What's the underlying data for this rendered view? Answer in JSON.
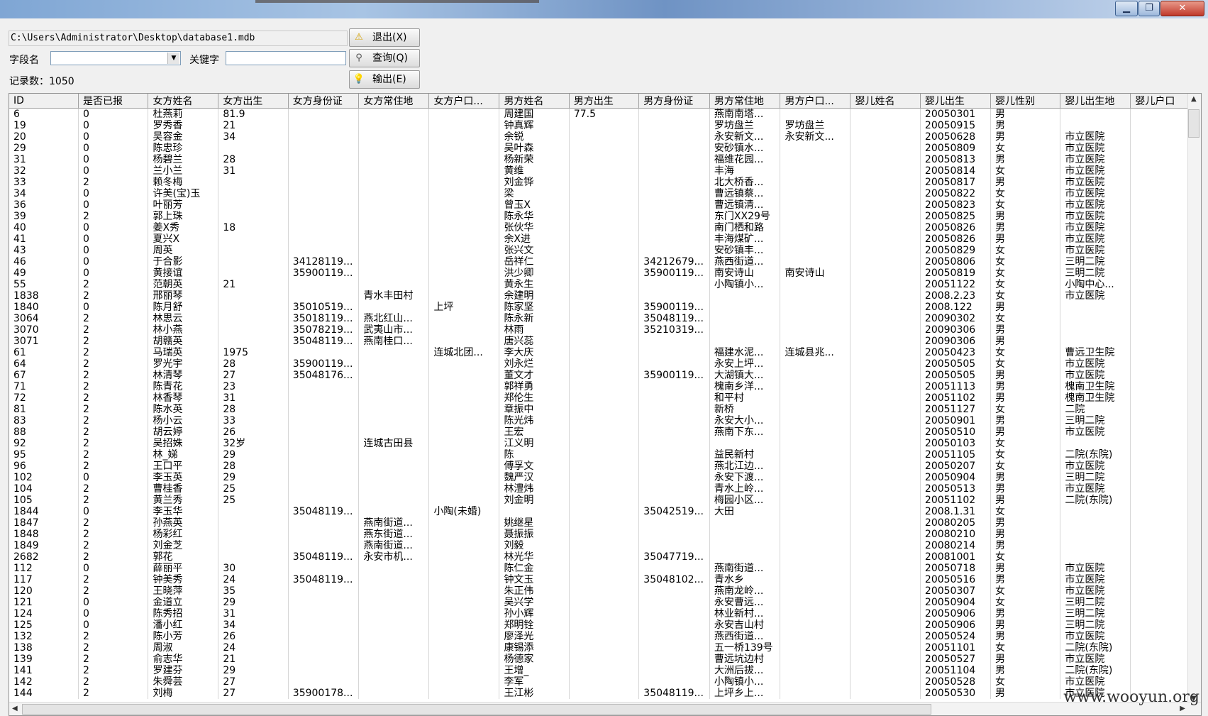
{
  "window": {
    "minimize_glyph": "▁",
    "maximize_glyph": "❐",
    "close_glyph": "✕"
  },
  "toolbar": {
    "path": "C:\\Users\\Administrator\\Desktop\\database1.mdb",
    "field_label": "字段名",
    "field_value": "",
    "keyword_label": "关键字",
    "keyword_value": "",
    "record_count_text": "记录数：1050",
    "exit_label": "退出(X)",
    "query_label": "查询(Q)",
    "export_label": "输出(E)",
    "exit_icon": "warning-icon",
    "query_icon": "search-icon",
    "export_icon": "lightbulb-icon"
  },
  "grid": {
    "columns": [
      "ID",
      "是否已报",
      "女方姓名",
      "女方出生",
      "女方身份证",
      "女方常住地",
      "女方户口...",
      "男方姓名",
      "男方出生",
      "男方身份证",
      "男方常住地",
      "男方户口...",
      "婴儿姓名",
      "婴儿出生",
      "婴儿性别",
      "婴儿出生地",
      "婴儿户口"
    ],
    "rows": [
      [
        "6",
        "0",
        "杜燕莉",
        "81.9",
        "",
        "",
        "",
        "周建国",
        "77.5",
        "",
        "燕南南塔...",
        "",
        "",
        "20050301",
        "男",
        ""
      ],
      [
        "19",
        "0",
        "罗秀香",
        "21",
        "",
        "",
        "",
        "钟真辉",
        "",
        "",
        "罗坊盘兰",
        "罗坊盘兰",
        "",
        "20050915",
        "男",
        ""
      ],
      [
        "20",
        "0",
        "吴容金",
        "34",
        "",
        "",
        "",
        "余锐",
        "",
        "",
        "永安新文...",
        "永安新文...",
        "",
        "20050628",
        "男",
        "市立医院"
      ],
      [
        "29",
        "0",
        "陈忠珍",
        "",
        "",
        "",
        "",
        "吴叶森",
        "",
        "",
        "安砂镇水...",
        "",
        "",
        "20050809",
        "女",
        "市立医院"
      ],
      [
        "31",
        "0",
        "杨碧兰",
        "28",
        "",
        "",
        "",
        "杨新荣",
        "",
        "",
        "福维花园...",
        "",
        "",
        "20050813",
        "男",
        "市立医院"
      ],
      [
        "32",
        "0",
        "兰小兰",
        "31",
        "",
        "",
        "",
        "黄维",
        "",
        "",
        "丰海",
        "",
        "",
        "20050814",
        "女",
        "市立医院"
      ],
      [
        "33",
        "2",
        "赖冬梅",
        "",
        "",
        "",
        "",
        "刘金铧",
        "",
        "",
        "北大桥香...",
        "",
        "",
        "20050817",
        "男",
        "市立医院"
      ],
      [
        "34",
        "0",
        "许美(宝)玉",
        "",
        "",
        "",
        "",
        "梁",
        "",
        "",
        "曹远镇蔡...",
        "",
        "",
        "20050822",
        "女",
        "市立医院"
      ],
      [
        "36",
        "0",
        "叶丽芳",
        "",
        "",
        "",
        "",
        "曾玉X",
        "",
        "",
        "曹远镇清...",
        "",
        "",
        "20050823",
        "女",
        "市立医院"
      ],
      [
        "39",
        "2",
        "郭上珠",
        "",
        "",
        "",
        "",
        "陈永华",
        "",
        "",
        "东门XX29号",
        "",
        "",
        "20050825",
        "男",
        "市立医院"
      ],
      [
        "40",
        "0",
        "姜X秀",
        "18",
        "",
        "",
        "",
        "张伙华",
        "",
        "",
        "南门栖和路",
        "",
        "",
        "20050826",
        "男",
        "市立医院"
      ],
      [
        "41",
        "0",
        "夏兴X",
        "",
        "",
        "",
        "",
        "余X进",
        "",
        "",
        "丰海煤矿...",
        "",
        "",
        "20050826",
        "男",
        "市立医院"
      ],
      [
        "43",
        "0",
        "周英",
        "",
        "",
        "",
        "",
        "张兴文",
        "",
        "",
        "安砂镇丰...",
        "",
        "",
        "20050829",
        "女",
        "市立医院"
      ],
      [
        "46",
        "0",
        "于合影",
        "",
        "34128119...",
        "",
        "",
        "岳祥仁",
        "",
        "34212679...",
        "燕西街道...",
        "",
        "",
        "20050806",
        "女",
        "三明二院"
      ],
      [
        "49",
        "0",
        "黄接谊",
        "",
        "35900119...",
        "",
        "",
        "洪少卿",
        "",
        "35900119...",
        "南安诗山",
        "南安诗山",
        "",
        "20050819",
        "女",
        "三明二院"
      ],
      [
        "55",
        "2",
        "范朝英",
        "21",
        "",
        "",
        "",
        "黄永生",
        "",
        "",
        "小陶镇小...",
        "",
        "",
        "20051122",
        "女",
        "小陶中心..."
      ],
      [
        "1838",
        "2",
        "邢丽琴",
        "",
        "",
        "青水丰田村",
        "",
        "余建明",
        "",
        "",
        "",
        "",
        "",
        "2008.2.23",
        "女",
        "市立医院"
      ],
      [
        "1840",
        "0",
        "陈月舒",
        "",
        "35010519...",
        "",
        "上坪",
        "陈家坚",
        "",
        "35900119...",
        "",
        "",
        "",
        "2008.122",
        "男",
        ""
      ],
      [
        "3064",
        "2",
        "林思云",
        "",
        "35018119...",
        "燕北红山...",
        "",
        "陈永新",
        "",
        "35048119...",
        "",
        "",
        "",
        "20090302",
        "女",
        ""
      ],
      [
        "3070",
        "2",
        "林小燕",
        "",
        "35078219...",
        "武夷山市...",
        "",
        "林雨",
        "",
        "35210319...",
        "",
        "",
        "",
        "20090306",
        "男",
        ""
      ],
      [
        "3071",
        "2",
        "胡赣英",
        "",
        "35048119...",
        "燕南桂口...",
        "",
        "唐兴蕊",
        "",
        "",
        "",
        "",
        "",
        "20090306",
        "男",
        ""
      ],
      [
        "61",
        "2",
        "马瑞英",
        "1975",
        "",
        "",
        "连城北团...",
        "李大庆",
        "",
        "",
        "福建水泥...",
        "连城县兆...",
        "",
        "20050423",
        "女",
        "曹远卫生院"
      ],
      [
        "64",
        "2",
        "罗光宇",
        "28",
        "35900119...",
        "",
        "",
        "刘永烂",
        "",
        "",
        "永安上坪...",
        "",
        "",
        "20050505",
        "女",
        "市立医院"
      ],
      [
        "67",
        "2",
        "林清琴",
        "27",
        "35048176...",
        "",
        "",
        "董文才",
        "",
        "35900119...",
        "大湖镇大...",
        "",
        "",
        "20050505",
        "男",
        "市立医院"
      ],
      [
        "71",
        "2",
        "陈青花",
        "23",
        "",
        "",
        "",
        "郭祥勇",
        "",
        "",
        "槐南乡洋...",
        "",
        "",
        "20051113",
        "男",
        "槐南卫生院"
      ],
      [
        "72",
        "2",
        "林香琴",
        "31",
        "",
        "",
        "",
        "郑伦生",
        "",
        "",
        "和平村",
        "",
        "",
        "20051102",
        "男",
        "槐南卫生院"
      ],
      [
        "81",
        "2",
        "陈水英",
        "28",
        "",
        "",
        "",
        "章振中",
        "",
        "",
        "新桥",
        "",
        "",
        "20051127",
        "女",
        "二院"
      ],
      [
        "83",
        "2",
        "杨小云",
        "33",
        "",
        "",
        "",
        "陈光炜",
        "",
        "",
        "永安大小...",
        "",
        "",
        "20050901",
        "男",
        "三明二院"
      ],
      [
        "88",
        "2",
        "胡云婷",
        "26",
        "",
        "",
        "",
        "王宏",
        "",
        "",
        "燕南下东...",
        "",
        "",
        "20050510",
        "男",
        "市立医院"
      ],
      [
        "92",
        "2",
        "吴招姝",
        "32岁",
        "",
        "连城古田县",
        "",
        "江义明",
        "",
        "",
        "",
        "",
        "",
        "20050103",
        "女",
        ""
      ],
      [
        "95",
        "2",
        "林_娣",
        "29",
        "",
        "",
        "",
        "陈",
        "",
        "",
        "益民新村",
        "",
        "",
        "20051105",
        "女",
        "二院(东院)"
      ],
      [
        "96",
        "2",
        "王口平",
        "28",
        "",
        "",
        "",
        "傅孚文",
        "",
        "",
        "燕北江边...",
        "",
        "",
        "20050207",
        "女",
        "市立医院"
      ],
      [
        "102",
        "0",
        "李玉英",
        "29",
        "",
        "",
        "",
        "魏严汉",
        "",
        "",
        "永安下渡...",
        "",
        "",
        "20050904",
        "男",
        "三明二院"
      ],
      [
        "104",
        "2",
        "曹桂香",
        "25",
        "",
        "",
        "",
        "林澧炜",
        "",
        "",
        "青水上岭...",
        "",
        "",
        "20050513",
        "男",
        "市立医院"
      ],
      [
        "105",
        "2",
        "黄兰秀",
        "25",
        "",
        "",
        "",
        "刘金明",
        "",
        "",
        "梅园小区...",
        "",
        "",
        "20051102",
        "男",
        "二院(东院)"
      ],
      [
        "1844",
        "0",
        "李玉华",
        "",
        "35048119...",
        "",
        "小陶(未婚)",
        "",
        "",
        "35042519...",
        "大田",
        "",
        "",
        "2008.1.31",
        "女",
        ""
      ],
      [
        "1847",
        "2",
        "孙燕英",
        "",
        "",
        "燕南街道...",
        "",
        "姚继星",
        "",
        "",
        "",
        "",
        "",
        "20080205",
        "男",
        ""
      ],
      [
        "1848",
        "2",
        "杨彩红",
        "",
        "",
        "燕东街道...",
        "",
        "聂振振",
        "",
        "",
        "",
        "",
        "",
        "20080210",
        "男",
        ""
      ],
      [
        "1849",
        "2",
        "刘金芝",
        "",
        "",
        "燕南街道...",
        "",
        "刘毅",
        "",
        "",
        "",
        "",
        "",
        "20080214",
        "男",
        ""
      ],
      [
        "2682",
        "2",
        "郭花",
        "",
        "35048119...",
        "永安市机...",
        "",
        "林光华",
        "",
        "35047719...",
        "",
        "",
        "",
        "20081001",
        "女",
        ""
      ],
      [
        "112",
        "0",
        "薛丽平",
        "30",
        "",
        "",
        "",
        "陈仁金",
        "",
        "",
        "燕南街道...",
        "",
        "",
        "20050718",
        "男",
        "市立医院"
      ],
      [
        "117",
        "2",
        "钟美秀",
        "24",
        "35048119...",
        "",
        "",
        "钟文玉",
        "",
        "35048102...",
        "青水乡",
        "",
        "",
        "20050516",
        "男",
        "市立医院"
      ],
      [
        "120",
        "2",
        "王晓萍",
        "35",
        "",
        "",
        "",
        "朱正伟",
        "",
        "",
        "燕南龙岭...",
        "",
        "",
        "20050307",
        "女",
        "市立医院"
      ],
      [
        "121",
        "0",
        "金道立",
        "29",
        "",
        "",
        "",
        "吴兴学",
        "",
        "",
        "永安曹远...",
        "",
        "",
        "20050904",
        "女",
        "三明二院"
      ],
      [
        "124",
        "0",
        "陈秀招",
        "31",
        "",
        "",
        "",
        "孙小辉",
        "",
        "",
        "林业新村...",
        "",
        "",
        "20050906",
        "男",
        "三明二院"
      ],
      [
        "125",
        "0",
        "潘小红",
        "34",
        "",
        "",
        "",
        "郑明铨",
        "",
        "",
        "永安吉山村",
        "",
        "",
        "20050906",
        "男",
        "三明二院"
      ],
      [
        "132",
        "2",
        "陈小芳",
        "26",
        "",
        "",
        "",
        "廖泽光",
        "",
        "",
        "燕西街道...",
        "",
        "",
        "20050524",
        "男",
        "市立医院"
      ],
      [
        "138",
        "2",
        "周淑",
        "24",
        "",
        "",
        "",
        "康锡添",
        "",
        "",
        "五一桥139号",
        "",
        "",
        "20051101",
        "女",
        "二院(东院)"
      ],
      [
        "139",
        "2",
        "俞志华",
        "21",
        "",
        "",
        "",
        "杨德家",
        "",
        "",
        "曹远坑边村",
        "",
        "",
        "20050527",
        "男",
        "市立医院"
      ],
      [
        "141",
        "2",
        "罗建芬",
        "29",
        "",
        "",
        "",
        "王增_",
        "",
        "",
        "大洲后拔...",
        "",
        "",
        "20051104",
        "男",
        "二院(东院)"
      ],
      [
        "142",
        "2",
        "朱舜芸",
        "27",
        "",
        "",
        "",
        "李军",
        "",
        "",
        "小陶镇小...",
        "",
        "",
        "20050528",
        "女",
        "市立医院"
      ],
      [
        "144",
        "2",
        "刘梅",
        "27",
        "35900178...",
        "",
        "",
        "王江彬",
        "",
        "35048119...",
        "上坪乡上...",
        "",
        "",
        "20050530",
        "男",
        "市立医院"
      ]
    ]
  },
  "watermark": "www.wooyun.org"
}
